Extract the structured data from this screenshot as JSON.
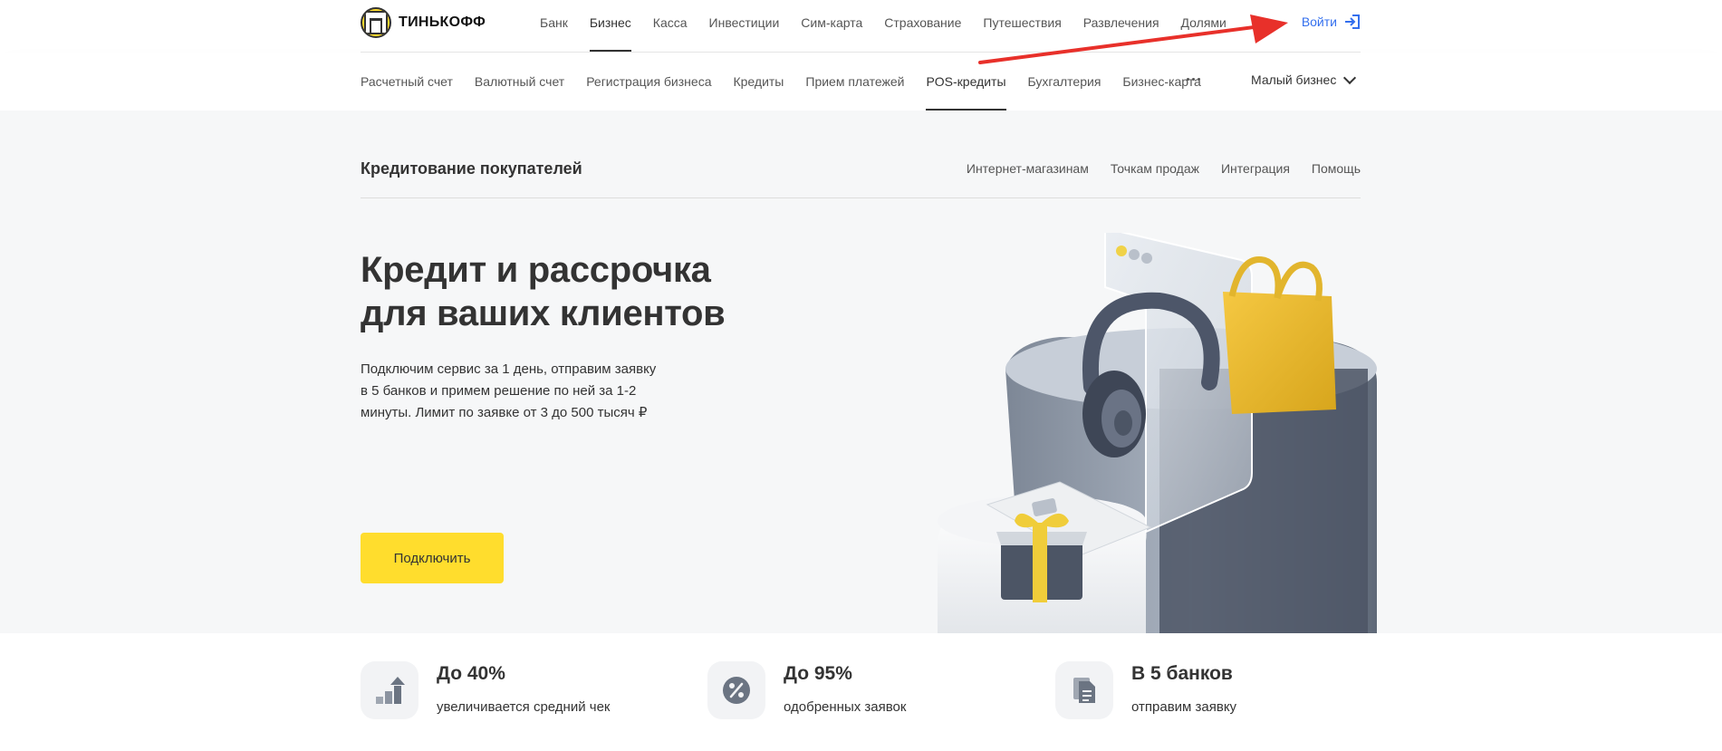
{
  "brand": {
    "name": "ТИНЬКОФФ"
  },
  "top_nav": {
    "items": [
      "Банк",
      "Бизнес",
      "Касса",
      "Инвестиции",
      "Сим-карта",
      "Страхование",
      "Путешествия",
      "Развлечения",
      "Долями"
    ],
    "active_index": 1,
    "login_label": "Войти"
  },
  "sub_nav": {
    "items": [
      "Расчетный счет",
      "Валютный счет",
      "Регистрация бизнеса",
      "Кредиты",
      "Прием платежей",
      "POS-кредиты",
      "Бухгалтерия",
      "Бизнес-карта"
    ],
    "active_index": 5,
    "segment_label": "Малый бизнес"
  },
  "section": {
    "title": "Кредитование покупателей",
    "links": [
      "Интернет-магазинам",
      "Точкам продаж",
      "Интеграция",
      "Помощь"
    ]
  },
  "hero": {
    "title_line1": "Кредит и рассрочка",
    "title_line2": "для ваших клиентов",
    "desc_line1": "Подключим сервис за 1 день, отправим заявку",
    "desc_line2": "в 5 банков и примем решение по ней за 1-2",
    "desc_line3": "минуты. Лимит по заявке от 3 до 500 тысяч ₽",
    "cta_label": "Подключить"
  },
  "stats": [
    {
      "value": "До 40%",
      "label": "увеличивается средний чек",
      "icon": "growth-icon"
    },
    {
      "value": "До 95%",
      "label": "одобренных заявок",
      "icon": "percent-icon"
    },
    {
      "value": "В 5 банков",
      "label": "отправим заявку",
      "icon": "documents-icon"
    }
  ],
  "colors": {
    "accent": "#ffdd2d",
    "link": "#336fee",
    "annotation_arrow": "#e8302a"
  }
}
